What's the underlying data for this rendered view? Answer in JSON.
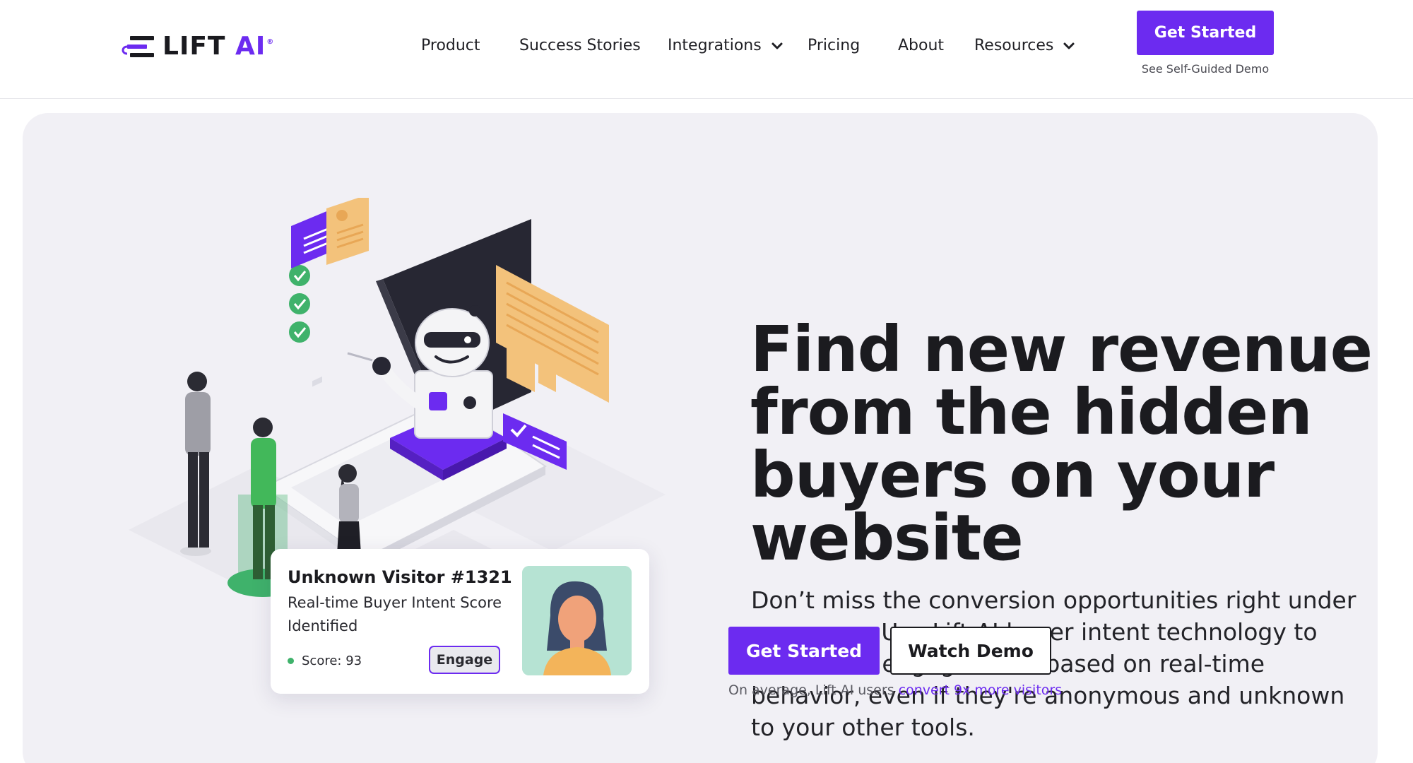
{
  "brand": {
    "logo_text": "LIFT",
    "logo_accent": "AI",
    "registered_mark": "®",
    "accent_color": "#6c2bf0"
  },
  "nav": {
    "items": [
      {
        "label": "Product"
      },
      {
        "label": "Success Stories"
      },
      {
        "label": "Integrations"
      },
      {
        "label": "Pricing"
      },
      {
        "label": "About"
      },
      {
        "label": "Resources"
      }
    ],
    "cta_label": "Get Started",
    "sub_link": "See Self-Guided Demo"
  },
  "hero": {
    "headline": "Find new revenue from the hidden buyers on your website",
    "body": "Don’t miss the conversion opportunities right under your nose. Use Lift AI buyer intent technology to reveal and engage them based on real-time behavior, even if they're anonymous and unknown to your other tools.",
    "primary_cta": "Get Started",
    "secondary_cta": "Watch Demo",
    "stat_prefix": "On average, Lift AI users ",
    "stat_link": "convert 9x more visitors"
  },
  "visitor_card": {
    "title": "Unknown Visitor #1321",
    "subtitle": "Real-time Buyer Intent Score Identified",
    "score_label": "Score: 93",
    "engage_label": "Engage",
    "status_color": "#3fb26b"
  }
}
